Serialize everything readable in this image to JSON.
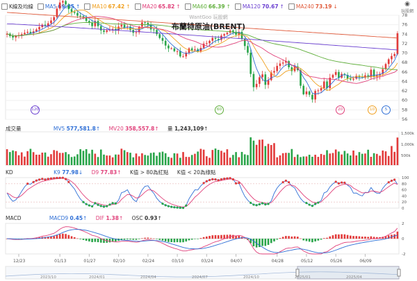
{
  "legend": {
    "title": "K線及均線",
    "items": [
      {
        "label": "MA5",
        "value": "69.45",
        "arrow": "↑",
        "color": "#2f6fd6"
      },
      {
        "label": "MA10",
        "value": "67.42",
        "arrow": "↑",
        "color": "#f0a020"
      },
      {
        "label": "MA20",
        "value": "65.82",
        "arrow": "↑",
        "color": "#e0407a"
      },
      {
        "label": "MA60",
        "value": "66.39",
        "arrow": "↑",
        "color": "#5fae3a"
      },
      {
        "label": "MA120",
        "value": "70.67",
        "arrow": "↑",
        "color": "#6a3fd0"
      },
      {
        "label": "MA240",
        "value": "73.19",
        "arrow": "↓",
        "color": "#e05a3a"
      }
    ]
  },
  "header": {
    "watermark": "WantGoo 玩股網",
    "title": "布蘭特原油(BRENT)",
    "corner_text": "玩股網",
    "corner_icon": "logo-icon"
  },
  "price_axis": [
    "78",
    "76",
    "74",
    "72",
    "70",
    "68",
    "66",
    "64",
    "62",
    "60",
    "58",
    "56"
  ],
  "ma_badges": [
    {
      "text": "120",
      "color": "#6a3fd0"
    },
    {
      "text": "60",
      "color": "#5fae3a"
    },
    {
      "text": "20",
      "color": "#e0407a"
    },
    {
      "text": "10",
      "color": "#f0a020"
    },
    {
      "text": "5",
      "color": "#2f6fd6"
    }
  ],
  "volume": {
    "label": "成交量",
    "mv5_label": "MV5",
    "mv5_value": "577,581.8",
    "mv5_arrow": "↑",
    "mv20_label": "MV20",
    "mv20_value": "358,557.8",
    "mv20_arrow": "↑",
    "qty_label": "量",
    "qty_value": "1,243,109",
    "qty_arrow": "↑",
    "axis": [
      "1,500k",
      "1,000k",
      "500k"
    ]
  },
  "kd": {
    "label": "KD",
    "k_label": "K9",
    "k_value": "77.98",
    "k_arrow": "↓",
    "d_label": "D9",
    "d_value": "77.83",
    "d_arrow": "↑",
    "note1": "K值 > 80為紅點",
    "note2": "K值 < 20為綠點",
    "axis": [
      "100",
      "80",
      "60",
      "40",
      "20",
      "0"
    ]
  },
  "macd": {
    "label": "MACD",
    "macd_label": "MACD9",
    "macd_value": "0.45",
    "macd_arrow": "↑",
    "dif_label": "DIF",
    "dif_value": "1.38",
    "dif_arrow": "↑",
    "osc_label": "OSC",
    "osc_value": "0.93",
    "osc_arrow": "↑",
    "axis": [
      "2",
      "0",
      "-2"
    ]
  },
  "x_axis_dates": [
    "12/23",
    "01/13",
    "01/27",
    "02/10",
    "02/24",
    "03/10",
    "03/24",
    "04/07",
    "04/28",
    "05/12",
    "05/26",
    "06/09"
  ],
  "navigator_dates": [
    "2023/10",
    "2024/01",
    "2024/04",
    "2024/07",
    "2024/10",
    "2025/01",
    "2025/04"
  ],
  "chart_data": {
    "type": "candlestick",
    "title": "布蘭特原油(BRENT)",
    "x_range": [
      "12/23",
      "06/09"
    ],
    "price_ylim": [
      56,
      78
    ],
    "price_ticks": [
      56,
      58,
      60,
      62,
      64,
      66,
      68,
      70,
      72,
      74,
      76,
      78
    ],
    "closes": [
      74.1,
      73.6,
      73.3,
      73.6,
      73.8,
      74.0,
      74.3,
      74.5,
      74.2,
      74.6,
      75.0,
      75.5,
      76.0,
      75.8,
      76.3,
      76.9,
      77.6,
      79.4,
      80.7,
      81.0,
      80.3,
      79.3,
      78.7,
      78.5,
      77.9,
      77.8,
      77.5,
      76.8,
      76.4,
      75.7,
      76.8,
      75.7,
      74.8,
      74.5,
      74.8,
      75.0,
      75.1,
      74.8,
      75.6,
      76.0,
      75.4,
      75.6,
      74.9,
      74.3,
      74.4,
      75.6,
      76.5,
      76.4,
      76.0,
      75.0,
      74.9,
      74.0,
      73.2,
      72.6,
      71.6,
      71.0,
      71.0,
      70.4,
      70.4,
      69.3,
      69.3,
      70.1,
      71.0,
      70.6,
      70.8,
      70.3,
      71.1,
      72.0,
      72.1,
      72.6,
      73.2,
      73.0,
      72.8,
      73.7,
      74.0,
      74.3,
      74.8,
      74.5,
      73.9,
      74.5,
      73.0,
      71.5,
      70.1,
      65.6,
      62.8,
      63.5,
      64.9,
      65.5,
      63.3,
      64.3,
      65.9,
      66.2,
      67.3,
      67.8,
      68.0,
      68.3,
      67.0,
      66.2,
      67.2,
      66.4,
      63.1,
      61.3,
      61.9,
      61.2,
      60.2,
      62.0,
      62.1,
      62.6,
      64.0,
      62.6,
      64.8,
      65.4,
      66.0,
      64.8,
      65.6,
      65.4,
      64.6,
      64.4,
      64.6,
      65.2,
      64.9,
      64.8,
      65.3,
      64.9,
      66.5,
      65.0,
      65.3,
      65.6,
      66.6,
      67.7,
      68.7,
      69.4,
      69.8,
      74.2
    ],
    "ma_lines": [
      {
        "name": "MA5",
        "value": 69.45
      },
      {
        "name": "MA10",
        "value": 67.42
      },
      {
        "name": "MA20",
        "value": 65.82
      },
      {
        "name": "MA60",
        "value": 66.39
      },
      {
        "name": "MA120",
        "value": 70.67
      },
      {
        "name": "MA240",
        "value": 73.19
      }
    ],
    "volume_last": 1243109,
    "volume_ylim": [
      0,
      1500000
    ],
    "kd_last": {
      "K9": 77.98,
      "D9": 77.83
    },
    "kd_ylim": [
      0,
      100
    ],
    "macd_last": {
      "MACD9": 0.45,
      "DIF": 1.38,
      "OSC": 0.93
    },
    "macd_ylim": [
      -2,
      2
    ]
  }
}
